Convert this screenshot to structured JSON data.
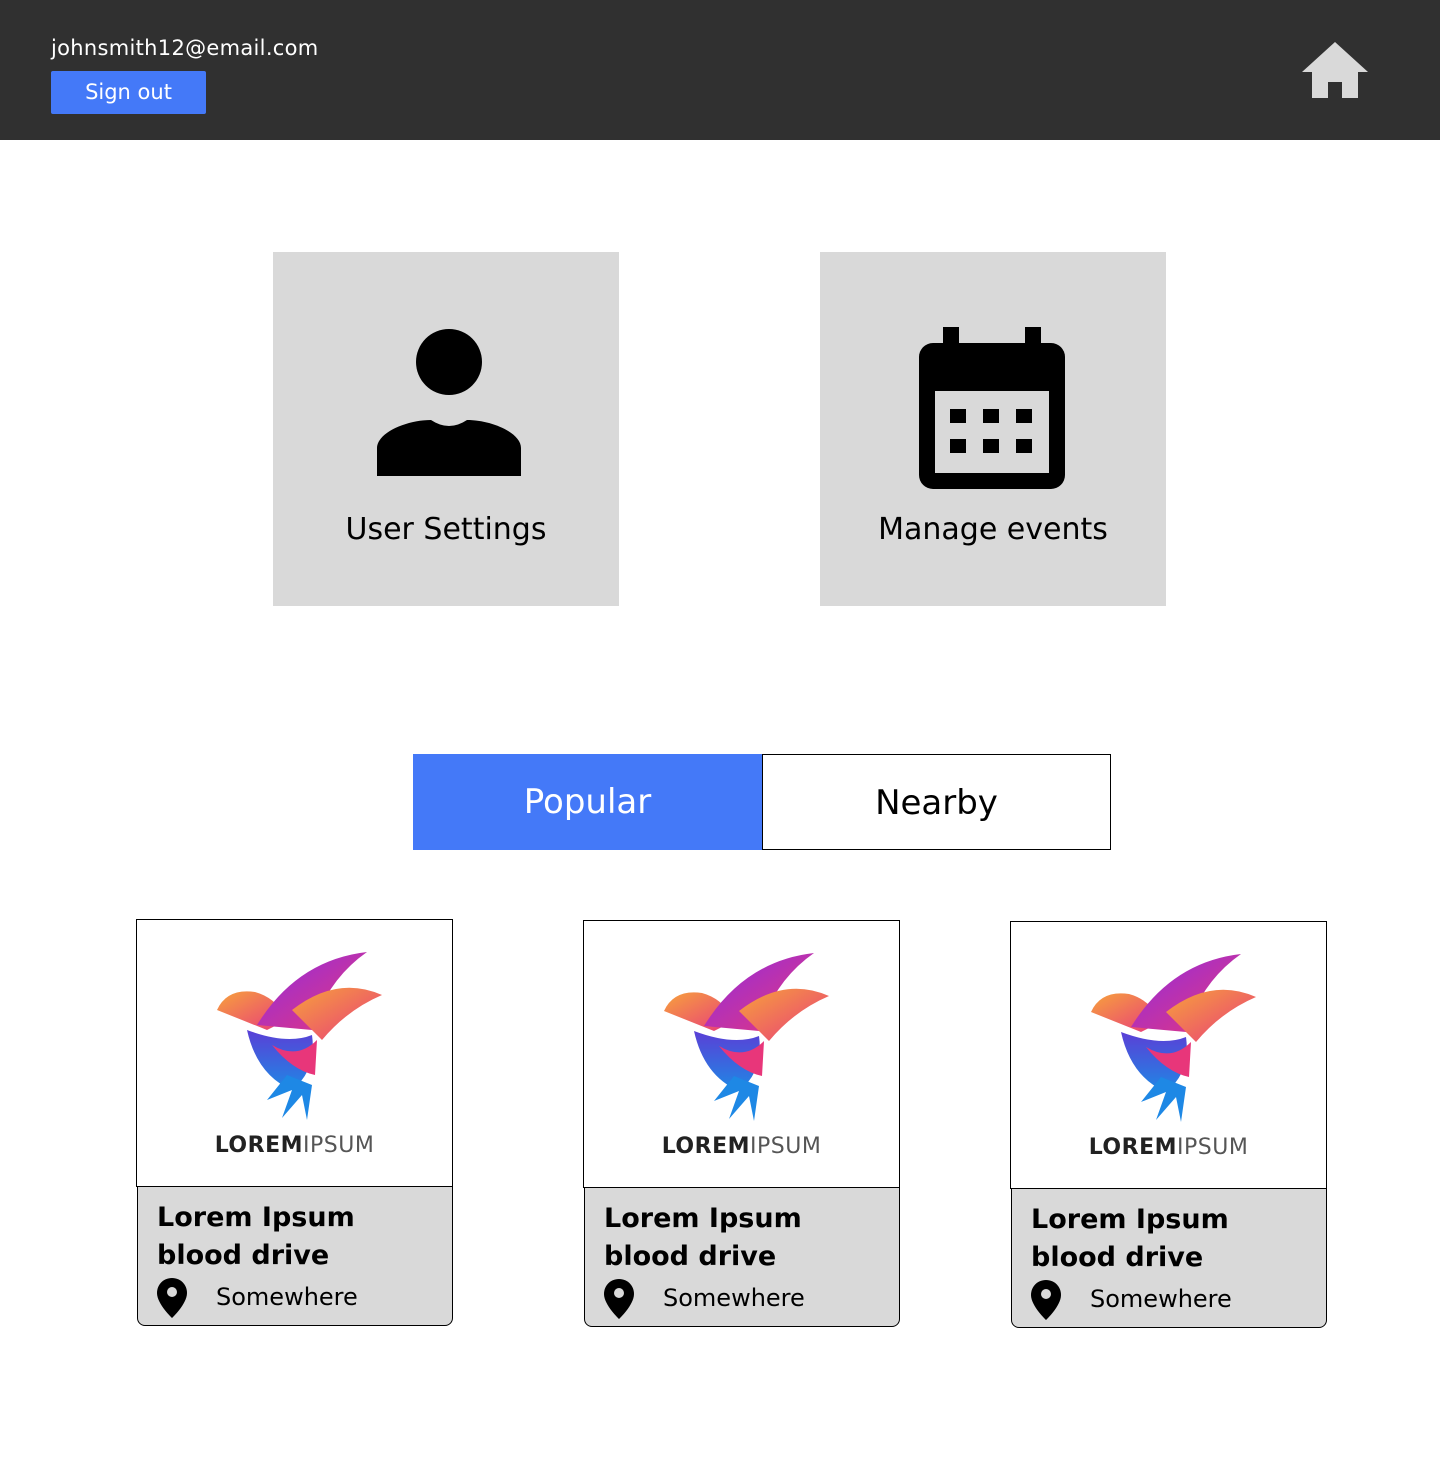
{
  "header": {
    "email": "johnsmith12@email.com",
    "sign_out_label": "Sign out",
    "home_icon": "home-icon"
  },
  "tiles": [
    {
      "label": "User Settings",
      "icon": "person-icon"
    },
    {
      "label": "Manage events",
      "icon": "calendar-icon"
    }
  ],
  "tabs": {
    "popular_label": "Popular",
    "nearby_label": "Nearby",
    "active": "Popular",
    "active_color": "#4479f8"
  },
  "cards": [
    {
      "title": "Lorem Ipsum blood drive",
      "location": "Somewhere",
      "logo_bold": "LOREM",
      "logo_light": "IPSUM"
    },
    {
      "title": "Lorem Ipsum blood drive",
      "location": "Somewhere",
      "logo_bold": "LOREM",
      "logo_light": "IPSUM"
    },
    {
      "title": "Lorem Ipsum blood drive",
      "location": "Somewhere",
      "logo_bold": "LOREM",
      "logo_light": "IPSUM"
    }
  ],
  "colors": {
    "topbar": "#303030",
    "accent": "#4479f8",
    "tile_bg": "#d9d9d9"
  }
}
